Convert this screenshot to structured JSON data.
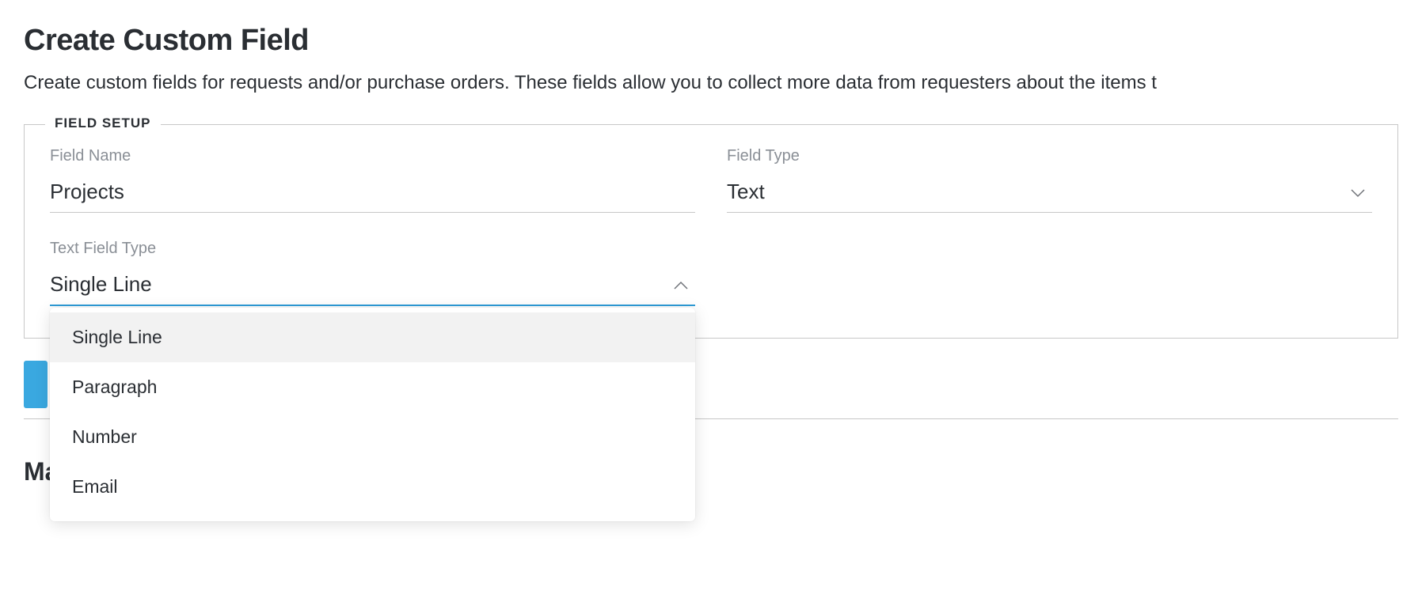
{
  "header": {
    "title": "Create Custom Field",
    "description": "Create custom fields for requests and/or purchase orders. These fields allow you to collect more data from requesters about the items t"
  },
  "fieldset": {
    "legend": "FIELD SETUP",
    "field_name": {
      "label": "Field Name",
      "value": "Projects"
    },
    "field_type": {
      "label": "Field Type",
      "value": "Text"
    },
    "text_field_type": {
      "label": "Text Field Type",
      "value": "Single Line",
      "options": [
        "Single Line",
        "Paragraph",
        "Number",
        "Email"
      ]
    }
  },
  "next_section": {
    "title_prefix": "Mar"
  }
}
